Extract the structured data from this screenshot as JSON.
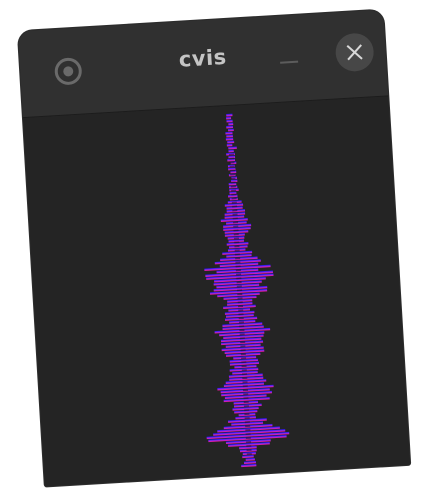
{
  "window": {
    "title": "cvis"
  },
  "icons": {
    "menu": "radio-target-icon",
    "minimize": "minimize-icon",
    "close": "close-x-icon"
  },
  "visualizer": {
    "gradient_top_color": "#1010ff",
    "gradient_mid_color": "#8a2be2",
    "gradient_bottom_color": "#ff1493",
    "background_color": "#242424"
  }
}
